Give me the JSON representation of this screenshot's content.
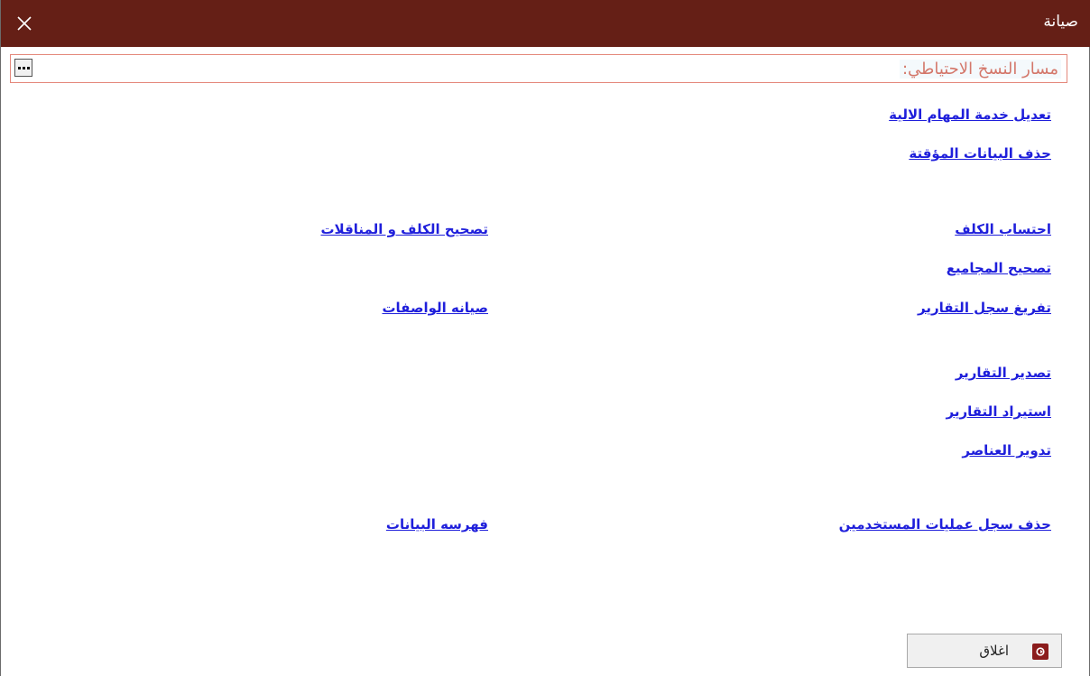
{
  "window": {
    "title": "صيانة",
    "close_icon": "close-icon",
    "titlebar_color": "#651f16"
  },
  "backup": {
    "label": "مسار النسخ الاحتياطي:",
    "browse_label": "...",
    "border_color": "#e4887b"
  },
  "links": {
    "edit_task_service": "تعديل خدمة المهام الالية",
    "delete_temp_data": "حذف البيانات المؤقتة",
    "calculate_costs": "احتساب الكلف",
    "correct_costs_transfers": "تصحيح الكلف و المناقلات",
    "correct_totals": "تصحيح المجاميع",
    "clear_reports_log": "تفريغ سجل التقارير",
    "maintain_specs": "صيانه الواصفات",
    "export_reports": "تصدير التقارير",
    "import_reports": "استيراد التقارير",
    "round_items": "تدوير العناصر",
    "delete_user_ops_log": "حذف سجل عمليات المستخدمين",
    "index_data": "فهرسه البيانات"
  },
  "footer": {
    "close_label": "اغلاق",
    "close_icon": "exit-icon",
    "link_color": "#1f1fdb"
  }
}
